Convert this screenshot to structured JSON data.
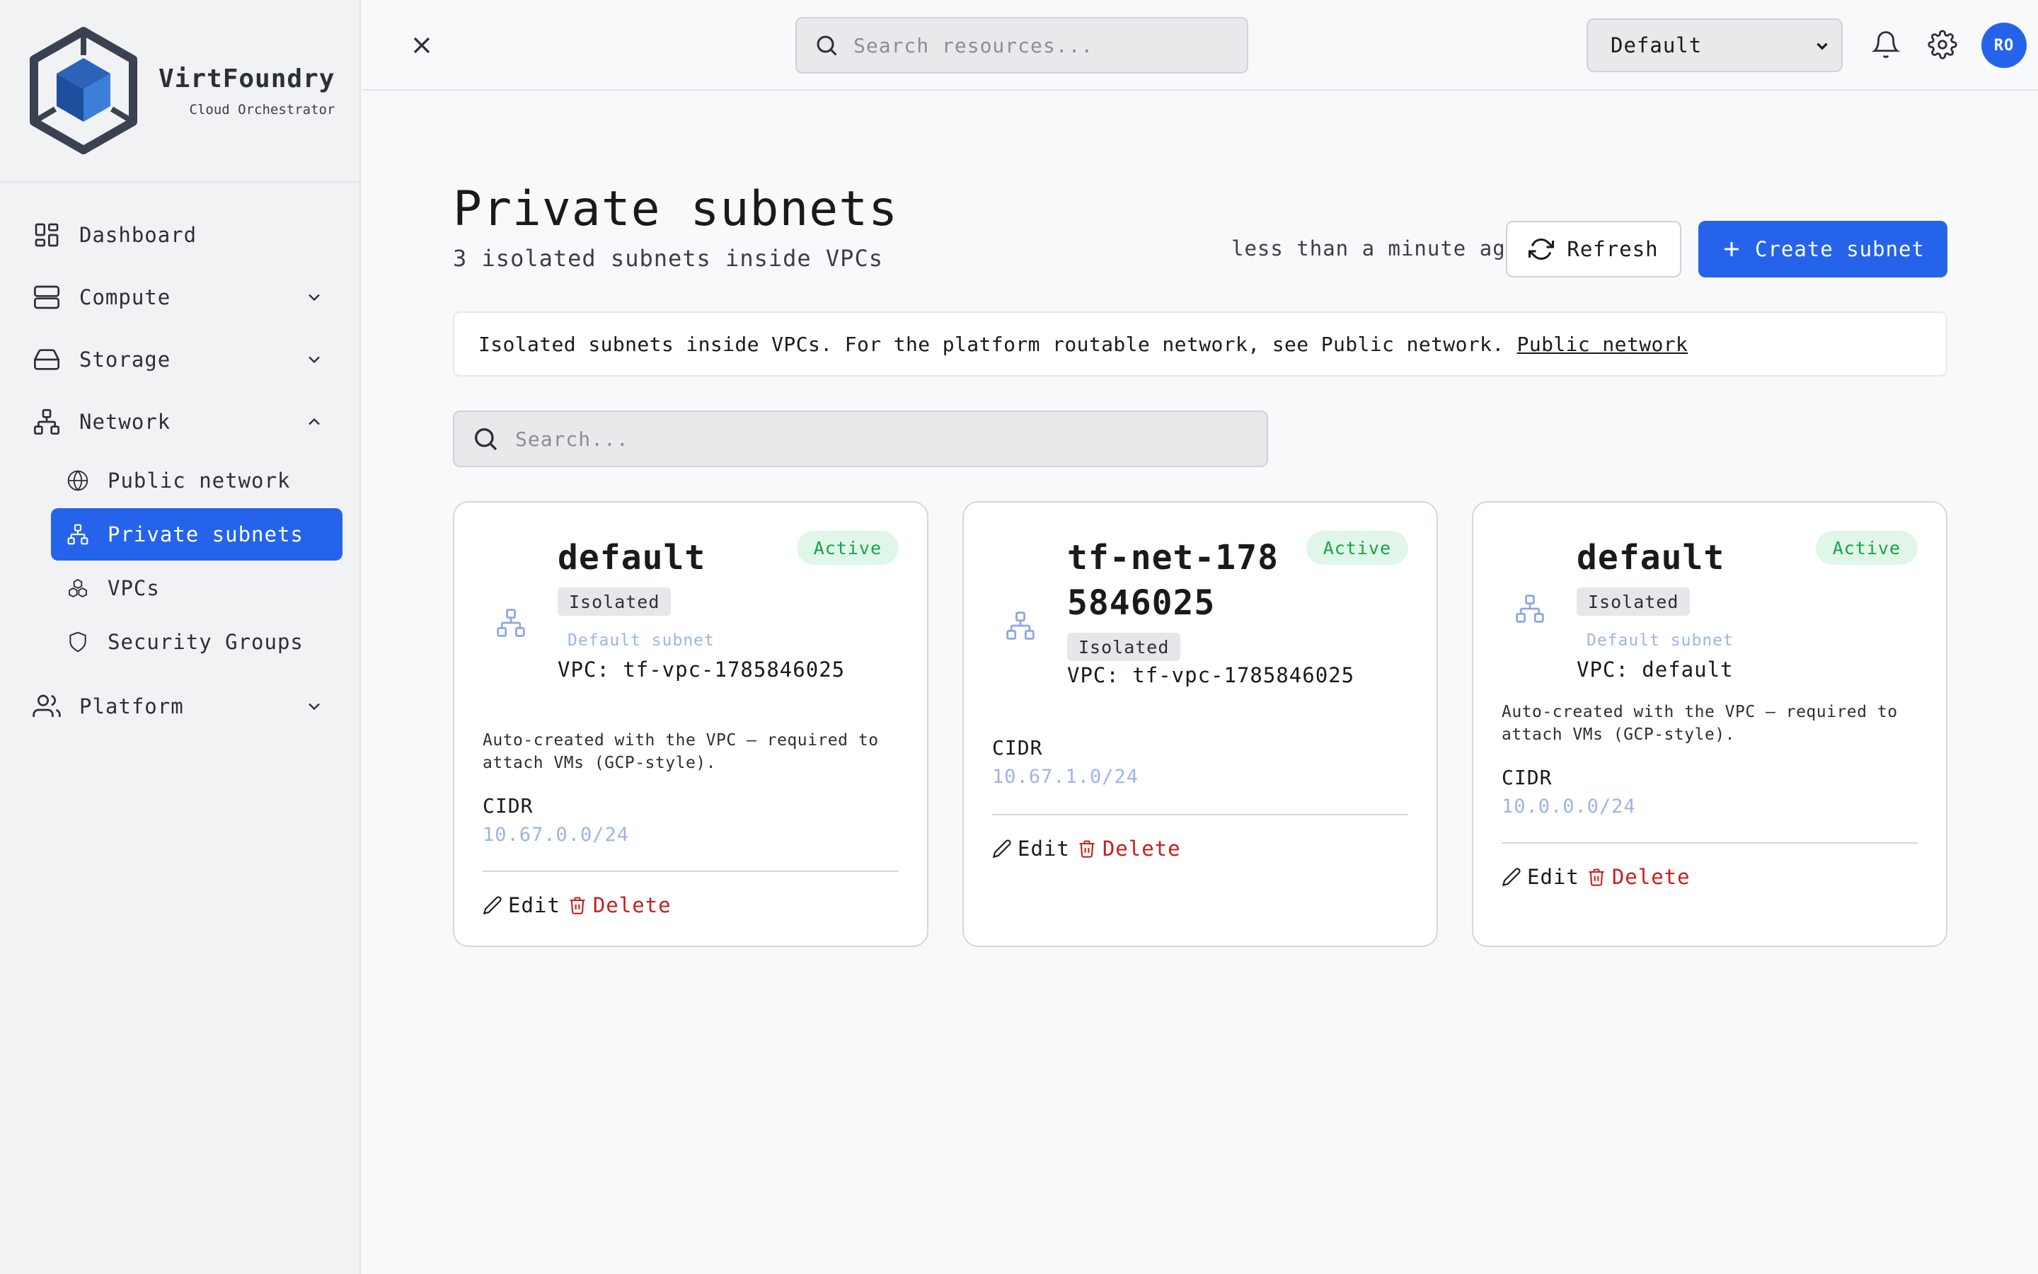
{
  "brand": {
    "name": "VirtFoundry",
    "subtitle": "Cloud Orchestrator"
  },
  "sidebar": {
    "items": [
      {
        "label": "Dashboard"
      },
      {
        "label": "Compute"
      },
      {
        "label": "Storage"
      },
      {
        "label": "Network"
      },
      {
        "label": "Platform"
      }
    ],
    "network_sub": [
      {
        "label": "Public network"
      },
      {
        "label": "Private subnets"
      },
      {
        "label": "VPCs"
      },
      {
        "label": "Security Groups"
      }
    ]
  },
  "topbar": {
    "search_placeholder": "Search resources...",
    "workspace": "Default",
    "avatar": "RO"
  },
  "page": {
    "title": "Private subnets",
    "subtitle": "3 isolated subnets inside VPCs",
    "updated": "less than a minute ago",
    "refresh_label": "Refresh",
    "create_label": "Create subnet",
    "banner_text": "Isolated subnets inside VPCs. For the platform routable network, see Public network.",
    "banner_link": "Public network",
    "search_placeholder": "Search..."
  },
  "subnets": [
    {
      "name": "default",
      "status": "Active",
      "tag": "Isolated",
      "default_label": "Default subnet",
      "vpc": "VPC: tf-vpc-1785846025",
      "description": "Auto-created with the VPC — required to attach VMs (GCP-style).",
      "cidr_label": "CIDR",
      "cidr": "10.67.0.0/24",
      "edit_label": "Edit",
      "delete_label": "Delete"
    },
    {
      "name": "tf-net-1785846025",
      "status": "Active",
      "tag": "Isolated",
      "vpc": "VPC: tf-vpc-1785846025",
      "cidr_label": "CIDR",
      "cidr": "10.67.1.0/24",
      "edit_label": "Edit",
      "delete_label": "Delete"
    },
    {
      "name": "default",
      "status": "Active",
      "tag": "Isolated",
      "default_label": "Default subnet",
      "vpc": "VPC: default",
      "description": "Auto-created with the VPC — required to attach VMs (GCP-style).",
      "cidr_label": "CIDR",
      "cidr": "10.0.0.0/24",
      "edit_label": "Edit",
      "delete_label": "Delete"
    }
  ],
  "colors": {
    "accent": "#2563eb",
    "active_bg": "#e0f6e8",
    "active_text": "#16a34a",
    "danger": "#c81e1e",
    "muted_link": "#9fb3e6"
  }
}
